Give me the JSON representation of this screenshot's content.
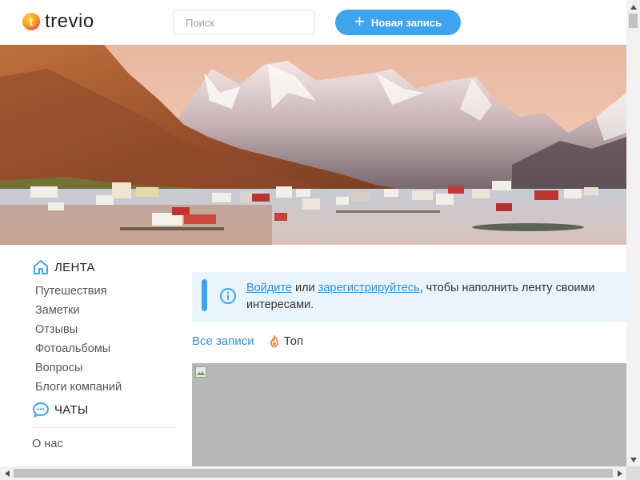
{
  "header": {
    "logo_mark": "t",
    "logo_text": "trevio",
    "search_placeholder": "Поиск",
    "new_post_label": "Новая запись"
  },
  "sidebar": {
    "feed_title": "ЛЕНТА",
    "items": [
      {
        "label": "Путешествия"
      },
      {
        "label": "Заметки"
      },
      {
        "label": "Отзывы"
      },
      {
        "label": "Фотоальбомы"
      },
      {
        "label": "Вопросы"
      },
      {
        "label": "Блоги компаний"
      }
    ],
    "chats_title": "ЧАТЫ",
    "about": "О нас"
  },
  "notice": {
    "login_link": "Войдите",
    "or": "или",
    "register_link": "зарегистрируйтесь",
    "rest": ", чтобы наполнить ленту своими интересами."
  },
  "tabs": {
    "all": "Все записи",
    "top": "Топ"
  },
  "colors": {
    "accent": "#3ea4ee",
    "notice_bg": "#eaf4fd",
    "link": "#2f8fd8"
  }
}
